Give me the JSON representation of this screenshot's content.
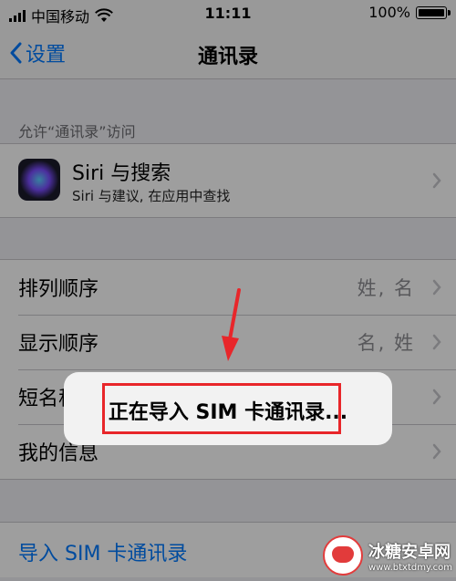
{
  "status_bar": {
    "carrier": "中国移动",
    "time": "11:11",
    "battery_text": "100%"
  },
  "nav": {
    "back_label": "设置",
    "title": "通讯录"
  },
  "access_section": {
    "header": "允许“通讯录”访问",
    "siri_title": "Siri 与搜索",
    "siri_subtitle": "Siri 与建议, 在应用中查找"
  },
  "settings_rows": [
    {
      "label": "排列顺序",
      "value": "姓, 名"
    },
    {
      "label": "显示顺序",
      "value": "名, 姓"
    },
    {
      "label": "短名称",
      "value": ""
    },
    {
      "label": "我的信息",
      "value": ""
    }
  ],
  "import_link": "导入 SIM 卡通讯录",
  "alert": {
    "message": "正在导入 SIM 卡通讯录..."
  },
  "colors": {
    "ios_blue": "#007aff",
    "highlight_red": "#e8262a"
  },
  "watermark": {
    "name": "冰糖安卓网",
    "url": "www.btxtdmy.com"
  }
}
